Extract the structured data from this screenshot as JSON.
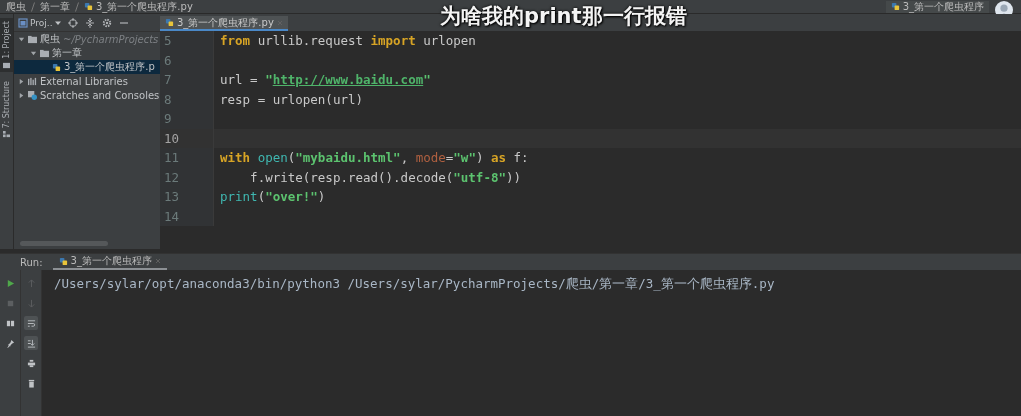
{
  "breadcrumbs": [
    {
      "label": "爬虫",
      "kind": "folder"
    },
    {
      "label": "第一章",
      "kind": "folder"
    },
    {
      "label": "3_第一个爬虫程序.py",
      "kind": "file"
    }
  ],
  "caption": "为啥我的print那一行报错",
  "run_config": {
    "label": "3_第一个爬虫程序"
  },
  "side_tabs": [
    {
      "label": "1: Project",
      "selected": true,
      "kind": "project"
    },
    {
      "label": "7: Structure",
      "selected": false,
      "kind": "structure"
    }
  ],
  "project_panel": {
    "title": "Proj..",
    "tree": [
      {
        "label": "爬虫",
        "hint": "~/PycharmProjects",
        "kind": "folder",
        "expanded": true,
        "selected": false,
        "children": [
          {
            "label": "第一章",
            "kind": "folder",
            "expanded": true,
            "selected": false,
            "children": [
              {
                "label": "3_第一个爬虫程序.p",
                "kind": "file",
                "selected": true
              }
            ]
          }
        ]
      },
      {
        "label": "External Libraries",
        "kind": "library",
        "expanded": false,
        "selected": false
      },
      {
        "label": "Scratches and Consoles",
        "kind": "scratches",
        "expanded": false,
        "selected": false
      }
    ]
  },
  "editor": {
    "tab": {
      "label": "3_第一个爬虫程序.py",
      "selected": true
    },
    "lines": [
      {
        "number": "5",
        "selected": false,
        "tokens": [
          {
            "text": "from",
            "kind": "keyword"
          },
          {
            "text": " urllib.request ",
            "kind": "plain"
          },
          {
            "text": "import",
            "kind": "keyword"
          },
          {
            "text": " urlopen",
            "kind": "plain"
          }
        ]
      },
      {
        "number": "6",
        "selected": false
      },
      {
        "number": "7",
        "selected": false,
        "tokens": [
          {
            "text": "url = ",
            "kind": "plain"
          },
          {
            "text": "\"",
            "kind": "string"
          },
          {
            "text": "http://www.baidu.com",
            "kind": "link"
          },
          {
            "text": "\"",
            "kind": "string"
          }
        ]
      },
      {
        "number": "8",
        "selected": false,
        "tokens": [
          {
            "text": "resp = urlopen(url)",
            "kind": "plain"
          }
        ]
      },
      {
        "number": "9",
        "selected": false
      },
      {
        "number": "10",
        "selected": true
      },
      {
        "number": "11",
        "selected": false,
        "tokens": [
          {
            "text": "with ",
            "kind": "keyword"
          },
          {
            "text": "open",
            "kind": "builtin"
          },
          {
            "text": "(",
            "kind": "plain"
          },
          {
            "text": "\"mybaidu.html\"",
            "kind": "string"
          },
          {
            "text": ", ",
            "kind": "plain"
          },
          {
            "text": "mode",
            "kind": "param"
          },
          {
            "text": "=",
            "kind": "plain"
          },
          {
            "text": "\"w\"",
            "kind": "string"
          },
          {
            "text": ") ",
            "kind": "plain"
          },
          {
            "text": "as",
            "kind": "keyword"
          },
          {
            "text": " f:",
            "kind": "plain"
          }
        ]
      },
      {
        "number": "12",
        "selected": false,
        "tokens": [
          {
            "text": "    f.write(resp.read().decode(",
            "kind": "plain"
          },
          {
            "text": "\"utf-8\"",
            "kind": "string"
          },
          {
            "text": "))",
            "kind": "plain"
          }
        ]
      },
      {
        "number": "13",
        "selected": false,
        "tokens": [
          {
            "text": "print",
            "kind": "builtin"
          },
          {
            "text": "(",
            "kind": "plain"
          },
          {
            "text": "\"over!\"",
            "kind": "string"
          },
          {
            "text": ")",
            "kind": "plain"
          }
        ]
      },
      {
        "number": "14",
        "selected": false
      }
    ]
  },
  "run_panel": {
    "label": "Run:",
    "tab": {
      "label": "3_第一个爬虫程序",
      "selected": true
    },
    "tools": [
      [
        {
          "kind": "run",
          "disabled": false,
          "on": false
        },
        {
          "kind": "stop",
          "disabled": true,
          "on": false
        },
        {
          "kind": "layout",
          "disabled": false,
          "on": false
        },
        {
          "kind": "pin",
          "disabled": false,
          "on": false
        }
      ],
      [
        {
          "kind": "up",
          "disabled": true,
          "on": false
        },
        {
          "kind": "down",
          "disabled": true,
          "on": false
        },
        {
          "kind": "wrap",
          "disabled": false,
          "on": true
        },
        {
          "kind": "scroll-end",
          "disabled": false,
          "on": true
        },
        {
          "kind": "print",
          "disabled": false,
          "on": false
        },
        {
          "kind": "trash",
          "disabled": false,
          "on": false
        }
      ]
    ],
    "console": [
      "/Users/sylar/opt/anaconda3/bin/python3 /Users/sylar/PycharmProjects/爬虫/第一章/3_第一个爬虫程序.py"
    ]
  }
}
